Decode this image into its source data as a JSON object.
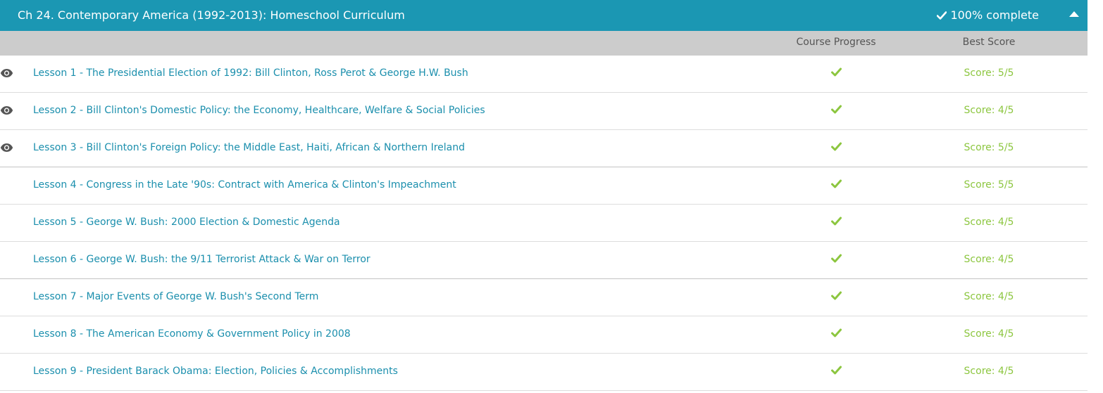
{
  "chapter": {
    "title": "Ch 24. Contemporary America (1992-2013): Homeschool Curriculum",
    "completion": "100% complete",
    "header_color": "#1b97b3"
  },
  "columns": {
    "progress": "Course Progress",
    "score": "Best Score"
  },
  "colors": {
    "link": "#1b8fad",
    "success": "#8cc63f",
    "column_header_bg": "#cccccc"
  },
  "lessons": [
    {
      "label": "Lesson 1 - The Presidential Election of 1992: Bill Clinton, Ross Perot & George H.W. Bush",
      "score": "Score: 5/5",
      "viewed": true,
      "completed": true
    },
    {
      "label": "Lesson 2 - Bill Clinton's Domestic Policy: the Economy, Healthcare, Welfare & Social Policies",
      "score": "Score: 4/5",
      "viewed": true,
      "completed": true
    },
    {
      "label": "Lesson 3 - Bill Clinton's Foreign Policy: the Middle East, Haiti, African & Northern Ireland",
      "score": "Score: 5/5",
      "viewed": true,
      "completed": true
    },
    {
      "label": "Lesson 4 - Congress in the Late '90s: Contract with America & Clinton's Impeachment",
      "score": "Score: 5/5",
      "viewed": false,
      "completed": true
    },
    {
      "label": "Lesson 5 - George W. Bush: 2000 Election & Domestic Agenda",
      "score": "Score: 4/5",
      "viewed": false,
      "completed": true
    },
    {
      "label": "Lesson 6 - George W. Bush: the 9/11 Terrorist Attack & War on Terror",
      "score": "Score: 4/5",
      "viewed": false,
      "completed": true
    },
    {
      "label": "Lesson 7 - Major Events of George W. Bush's Second Term",
      "score": "Score: 4/5",
      "viewed": false,
      "completed": true
    },
    {
      "label": "Lesson 8 - The American Economy & Government Policy in 2008",
      "score": "Score: 4/5",
      "viewed": false,
      "completed": true
    },
    {
      "label": "Lesson 9 - President Barack Obama: Election, Policies & Accomplishments",
      "score": "Score: 4/5",
      "viewed": false,
      "completed": true
    }
  ]
}
